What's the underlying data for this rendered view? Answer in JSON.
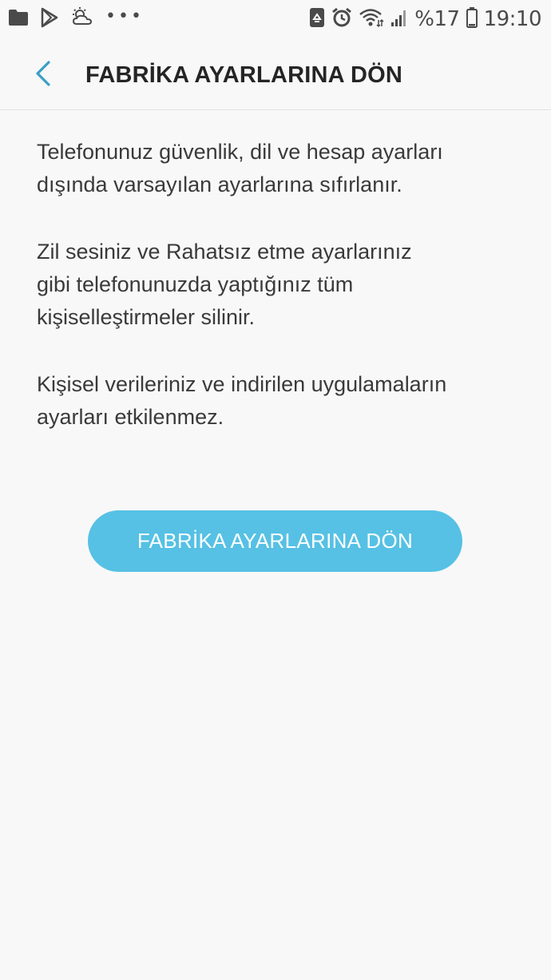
{
  "status_bar": {
    "battery_percent": "%17",
    "time": "19:10",
    "icons": [
      "folder-icon",
      "play-store-icon",
      "weather-icon",
      "more-notifications-icon",
      "recycle-app-icon",
      "alarm-icon",
      "wifi-icon",
      "signal-icon",
      "battery-icon"
    ],
    "more_dots": "•••"
  },
  "header": {
    "title": "FABRİKA AYARLARINA DÖN",
    "back_icon": "chevron-left-icon",
    "accent_color": "#3a9fc4"
  },
  "content": {
    "paragraphs": [
      "Telefonunuz güvenlik, dil ve hesap ayarları\ndışında varsayılan ayarlarına sıfırlanır.",
      "Zil sesiniz ve Rahatsız etme ayarlarınız\ngibi telefonunuzda yaptığınız tüm\nkişiselleştirmeler silinir.",
      "Kişisel verileriniz ve indirilen uygulamaların\nayarları etkilenmez."
    ]
  },
  "reset_button": {
    "label": "FABRİKA AYARLARINA DÖN",
    "color": "#56c1e4"
  }
}
